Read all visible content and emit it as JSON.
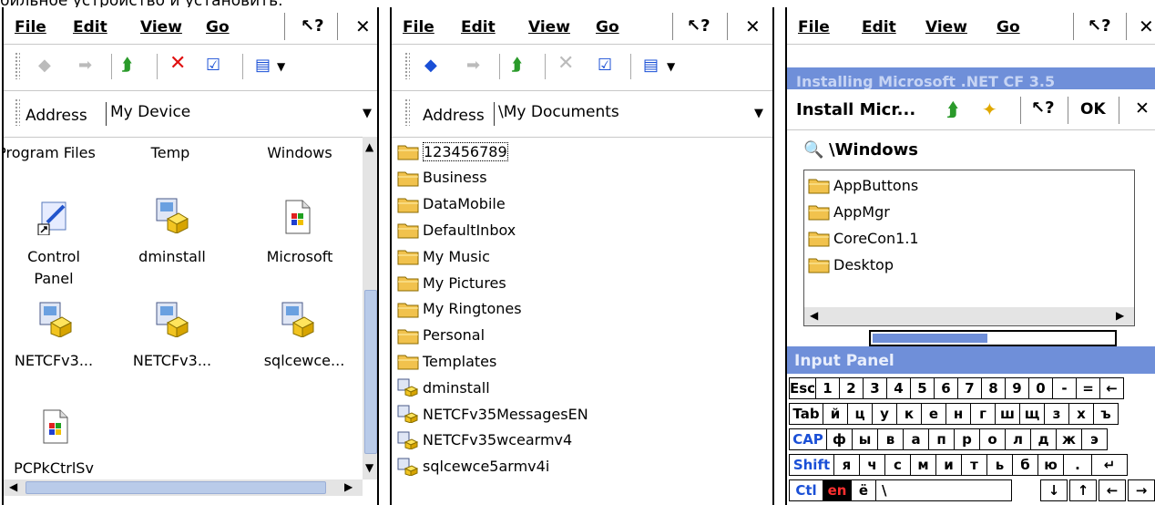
{
  "caption": "бильное устройство и установить.",
  "menus": [
    "File",
    "Edit",
    "View",
    "Go"
  ],
  "panel1": {
    "address_label": "Address",
    "address_value": "My Device",
    "columns": [
      "Program Files",
      "Temp",
      "Windows"
    ],
    "icons": [
      {
        "label1": "Control",
        "label2": "Panel",
        "icon": "control-panel-icon"
      },
      {
        "label1": "dminstall",
        "label2": "",
        "icon": "installer-icon"
      },
      {
        "label1": "Microsoft",
        "label2": "",
        "icon": "windows-file-icon"
      },
      {
        "label1": "NETCFv3...",
        "label2": "",
        "icon": "installer-icon"
      },
      {
        "label1": "NETCFv3...",
        "label2": "",
        "icon": "installer-icon"
      },
      {
        "label1": "sqlcewce...",
        "label2": "",
        "icon": "installer-icon"
      },
      {
        "label1": "PCPkCtrlSv",
        "label2": "",
        "icon": "windows-file-icon"
      }
    ]
  },
  "panel2": {
    "address_label": "Address",
    "address_value": "\\My Documents",
    "items": [
      {
        "label": "123456789",
        "type": "folder"
      },
      {
        "label": "Business",
        "type": "folder"
      },
      {
        "label": "DataMobile",
        "type": "folder"
      },
      {
        "label": "DefaultInbox",
        "type": "folder"
      },
      {
        "label": "My Music",
        "type": "folder"
      },
      {
        "label": "My Pictures",
        "type": "folder"
      },
      {
        "label": "My Ringtones",
        "type": "folder"
      },
      {
        "label": "Personal",
        "type": "folder"
      },
      {
        "label": "Templates",
        "type": "folder"
      },
      {
        "label": "dminstall",
        "type": "installer"
      },
      {
        "label": "NETCFv35MessagesEN",
        "type": "installer"
      },
      {
        "label": "NETCFv35wcearmv4",
        "type": "installer"
      },
      {
        "label": "sqlcewce5armv4i",
        "type": "installer"
      }
    ]
  },
  "panel3": {
    "behind_title": "Installing Microsoft .NET CF 3.5",
    "dialog_title": "Install Micr...",
    "ok_label": "OK",
    "path": "\\Windows",
    "folders": [
      "AppButtons",
      "AppMgr",
      "CoreCon1.1",
      "Desktop"
    ],
    "input_panel_title": "Input Panel",
    "keyboard": {
      "row1": [
        "Esc",
        "1",
        "2",
        "3",
        "4",
        "5",
        "6",
        "7",
        "8",
        "9",
        "0",
        "-",
        "=",
        "←"
      ],
      "row2": [
        "Tab",
        "й",
        "ц",
        "у",
        "к",
        "е",
        "н",
        "г",
        "ш",
        "щ",
        "з",
        "х",
        "ъ"
      ],
      "row3": [
        "CAP",
        "ф",
        "ы",
        "в",
        "а",
        "п",
        "р",
        "о",
        "л",
        "д",
        "ж",
        "э"
      ],
      "row4": [
        "Shift",
        "я",
        "ч",
        "с",
        "м",
        "и",
        "т",
        "ь",
        "б",
        "ю",
        ".",
        "↵"
      ],
      "row5": [
        "Ctl",
        "en",
        "ё",
        "\\",
        "↓",
        "↑",
        "←",
        "→"
      ]
    }
  },
  "colors": {
    "accent": "#1a4fd6",
    "title_bar": "#6f8fd9",
    "delete_red": "#e01010",
    "folder": "#f1c24d"
  }
}
